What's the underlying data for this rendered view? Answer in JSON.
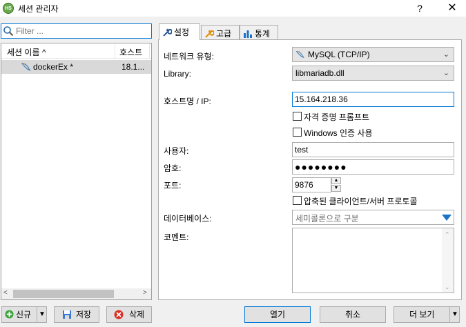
{
  "window": {
    "app_icon_text": "HS",
    "title": "세션 관리자",
    "help": "?",
    "close": "✕"
  },
  "filter": {
    "placeholder": "Filter ..."
  },
  "session_list": {
    "columns": [
      "세션 이름 ^",
      "호스트"
    ],
    "rows": [
      {
        "name": "dockerEx *",
        "host": "18.1..."
      }
    ]
  },
  "tabs": [
    {
      "label": "설정",
      "icon": "wrench-icon",
      "active": true
    },
    {
      "label": "고급",
      "icon": "wrench-icon-orange",
      "active": false
    },
    {
      "label": "통계",
      "icon": "bar-chart-icon",
      "active": false
    }
  ],
  "settings": {
    "network_type_label": "네트워크 유형:",
    "network_type_value": "MySQL (TCP/IP)",
    "library_label": "Library:",
    "library_value": "libmariadb.dll",
    "host_label": "호스트명 / IP:",
    "host_value": "15.164.218.36",
    "prompt_credentials": "자격 증명 프롬프트",
    "windows_auth": "Windows 인증 사용",
    "user_label": "사용자:",
    "user_value": "test",
    "password_label": "암호:",
    "password_value": "●●●●●●●●",
    "port_label": "포트:",
    "port_value": "9876",
    "compressed_protocol": "압축된 클라이언트/서버 프로토콜",
    "database_label": "데이터베이스:",
    "database_placeholder": "세미콜론으로 구분",
    "comment_label": "코멘트:"
  },
  "buttons": {
    "new": "신규",
    "save": "저장",
    "delete": "삭제",
    "open": "열기",
    "cancel": "취소",
    "more": "더 보기"
  },
  "colors": {
    "focus_border": "#0078d7",
    "selected_row": "#d9d9d9",
    "accent_blue": "#0078d7"
  }
}
